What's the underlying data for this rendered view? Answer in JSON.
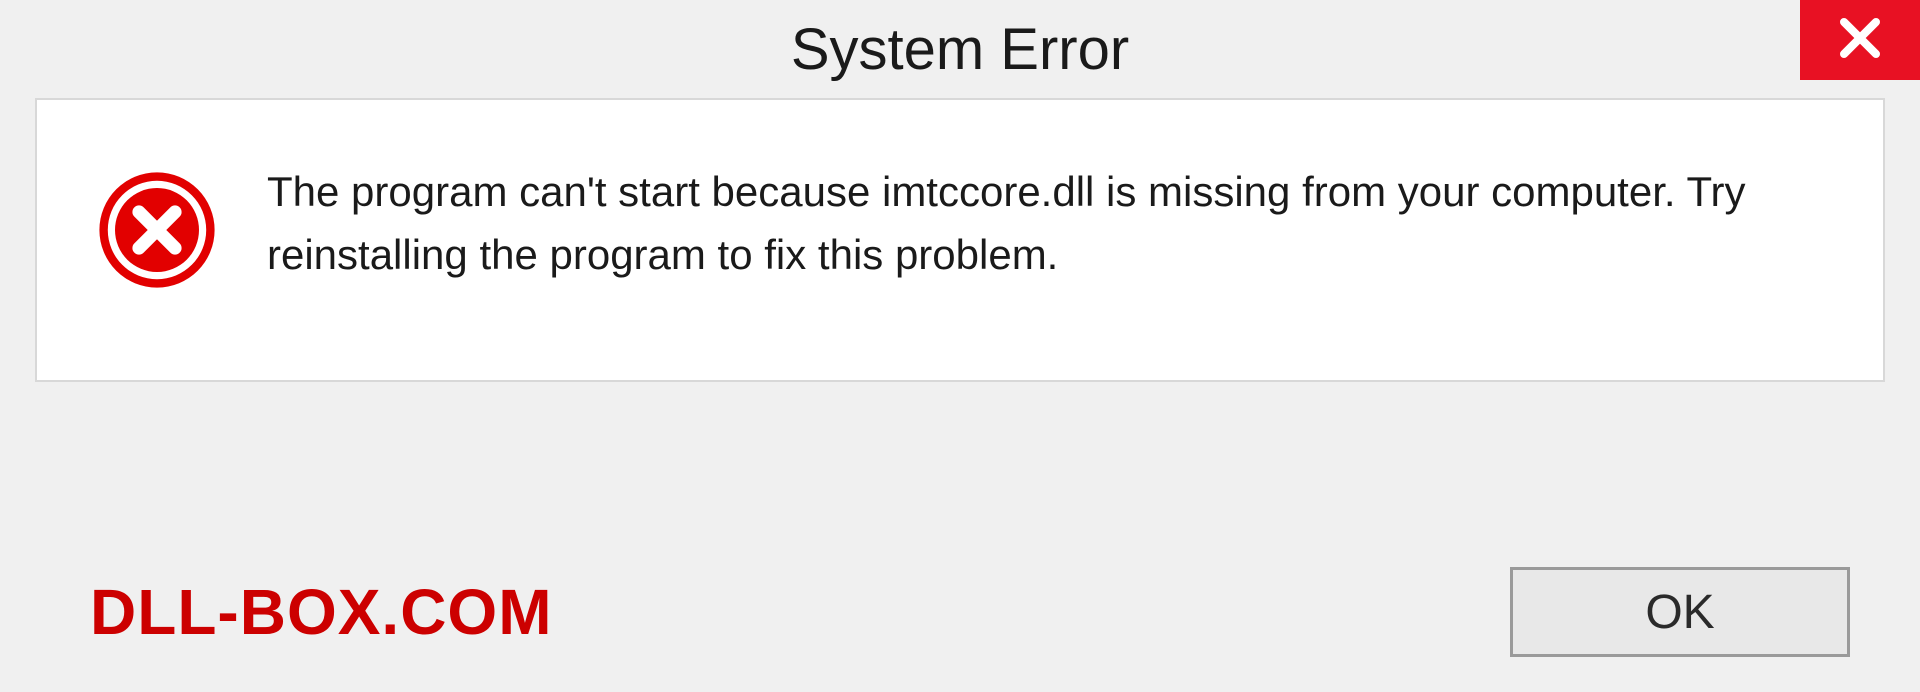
{
  "dialog": {
    "title": "System Error",
    "message": "The program can't start because imtccore.dll is missing from your computer. Try reinstalling the program to fix this problem.",
    "ok_label": "OK"
  },
  "watermark": "DLL-BOX.COM",
  "colors": {
    "close_bg": "#e81123",
    "error_icon": "#e20000",
    "watermark": "#cc0000"
  }
}
